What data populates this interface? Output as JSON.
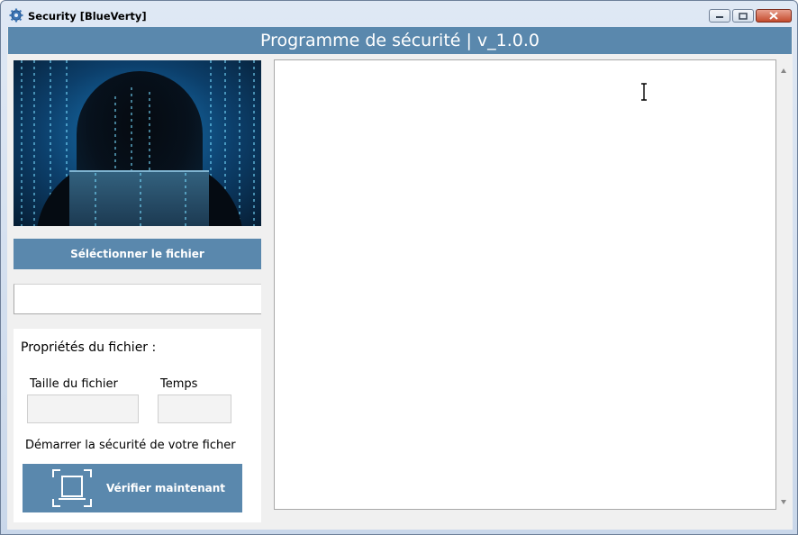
{
  "window": {
    "title": "Security [BlueVerty]"
  },
  "header": {
    "title": "Programme de sécurité | v_1.0.0"
  },
  "left_panel": {
    "select_button": "Séléctionner le fichier",
    "file_path": "",
    "properties": {
      "title": "Propriétés du fichier :",
      "size_label": "Taille du fichier",
      "size_value": "",
      "time_label": "Temps",
      "time_value": "",
      "start_text": "Démarrer la sécurité de votre ficher",
      "verify_button": "Vérifier maintenant"
    }
  },
  "output": {
    "text": ""
  },
  "colors": {
    "accent": "#5a88ad",
    "panel": "#ffffff",
    "background": "#f0f0f0"
  },
  "icons": [
    "gear-icon",
    "minimize-icon",
    "maximize-icon",
    "close-icon",
    "scan-icon",
    "text-cursor-icon"
  ]
}
